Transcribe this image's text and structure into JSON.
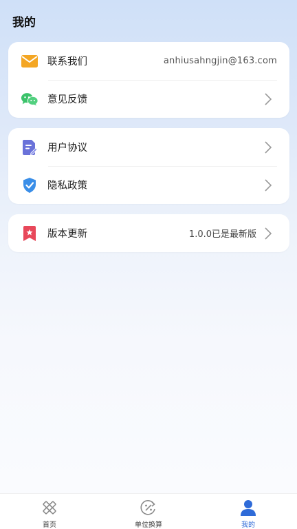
{
  "header": {
    "title": "我的"
  },
  "contact_card": {
    "contact": {
      "label": "联系我们",
      "value": "anhiusahngjin@163.com",
      "icon": "mail-icon"
    },
    "feedback": {
      "label": "意见反馈",
      "icon": "wechat-icon"
    }
  },
  "policy_card": {
    "agreement": {
      "label": "用户协议",
      "icon": "document-icon"
    },
    "privacy": {
      "label": "隐私政策",
      "icon": "shield-icon"
    }
  },
  "version_card": {
    "update": {
      "label": "版本更新",
      "value": "1.0.0已是最新版",
      "icon": "bookmark-icon"
    }
  },
  "tabbar": {
    "tabs": [
      {
        "label": "首页",
        "icon": "ruler-pencil-icon",
        "active": false
      },
      {
        "label": "单位换算",
        "icon": "conversion-icon",
        "active": false
      },
      {
        "label": "我的",
        "icon": "user-icon",
        "active": true
      }
    ]
  },
  "colors": {
    "accent": "#2f6bd8",
    "mail": "#f4a623",
    "wechat": "#3bc26a",
    "document": "#6a72d9",
    "shield": "#3a8ee8",
    "bookmark": "#e8485a"
  }
}
